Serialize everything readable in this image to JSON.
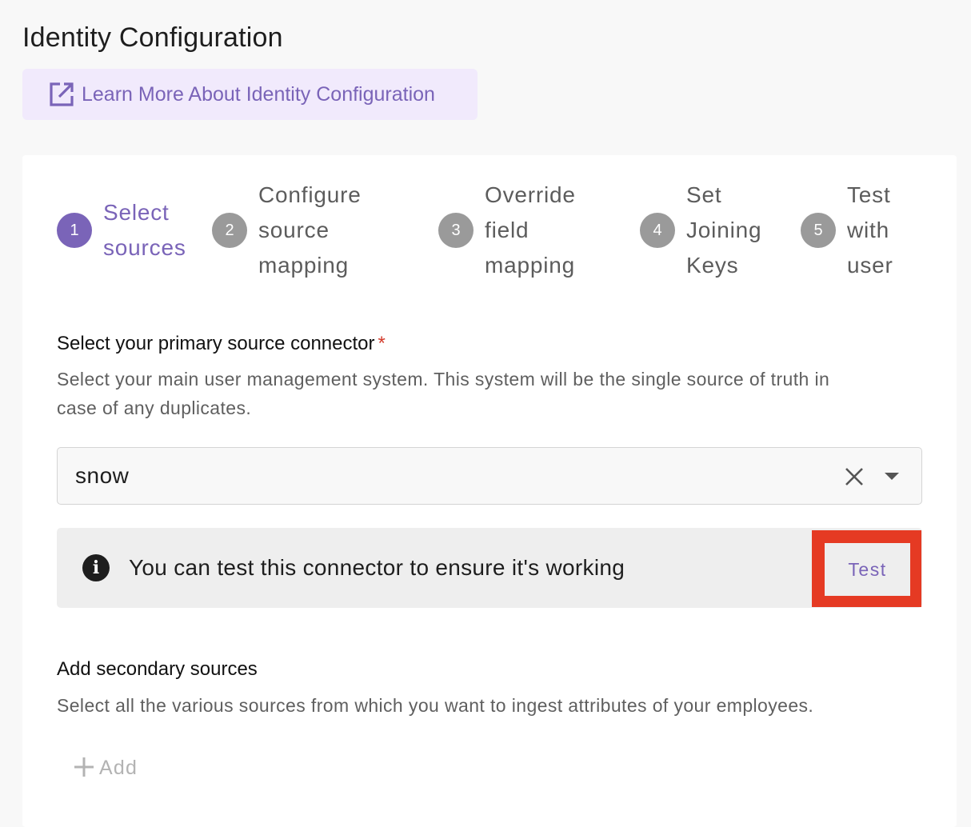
{
  "page": {
    "title": "Identity Configuration",
    "learn_more_label": "Learn More About Identity Configuration"
  },
  "stepper": {
    "steps": [
      {
        "number": "1",
        "line1": "Select",
        "line2": "sources",
        "line3": "",
        "active": true
      },
      {
        "number": "2",
        "line1": "Configure",
        "line2": "source",
        "line3": "mapping",
        "active": false
      },
      {
        "number": "3",
        "line1": "Override",
        "line2": "field",
        "line3": "mapping",
        "active": false
      },
      {
        "number": "4",
        "line1": "Set",
        "line2": "Joining",
        "line3": "Keys",
        "active": false
      },
      {
        "number": "5",
        "line1": "Test",
        "line2": "with",
        "line3": "user",
        "active": false
      }
    ]
  },
  "primary": {
    "label": "Select your primary source connector",
    "required_mark": "*",
    "helper_line1": "Select your main user management system. This system will be the single source of truth in",
    "helper_line2": "case of any duplicates.",
    "selected_value": "snow"
  },
  "info": {
    "message": "You can test this connector to ensure it's working",
    "test_button": "Test",
    "highlight_color": "#e53a23"
  },
  "secondary": {
    "label": "Add secondary sources",
    "helper": "Select all the various sources from which you want to ingest attributes of your employees.",
    "add_button": "Add"
  },
  "colors": {
    "accent": "#7a64b8",
    "accent_bg": "#f1eafc",
    "inactive_step": "#9a9a9a"
  }
}
